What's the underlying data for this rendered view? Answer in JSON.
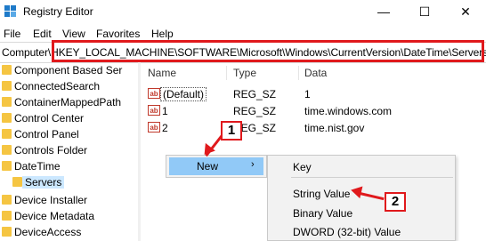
{
  "window": {
    "title": "Registry Editor",
    "minimize": "—",
    "maximize": "☐",
    "close": "✕"
  },
  "menu": [
    "File",
    "Edit",
    "View",
    "Favorites",
    "Help"
  ],
  "address": "Computer\\HKEY_LOCAL_MACHINE\\SOFTWARE\\Microsoft\\Windows\\CurrentVersion\\DateTime\\Servers",
  "tree": [
    "Component Based Ser",
    "ConnectedSearch",
    "ContainerMappedPath",
    "Control Center",
    "Control Panel",
    "Controls Folder",
    "DateTime",
    "Servers",
    "Device Installer",
    "Device Metadata",
    "DeviceAccess"
  ],
  "columns": {
    "name": "Name",
    "type": "Type",
    "data": "Data"
  },
  "values": [
    {
      "icon": "ab",
      "name": "(Default)",
      "type": "REG_SZ",
      "data": "1"
    },
    {
      "icon": "ab",
      "name": "1",
      "type": "REG_SZ",
      "data": "time.windows.com"
    },
    {
      "icon": "ab",
      "name": "2",
      "type": "REG_SZ",
      "data": "time.nist.gov"
    }
  ],
  "context_menu": {
    "new_label": "New",
    "submenu_arrow": "›"
  },
  "submenu": [
    "Key",
    "String Value",
    "Binary Value",
    "DWORD (32-bit) Value"
  ],
  "annotations": {
    "step1": "1",
    "step2": "2",
    "accent": "#e0191c"
  },
  "icons": [
    "regedit-app-icon",
    "folder-icon",
    "string-value-icon"
  ]
}
